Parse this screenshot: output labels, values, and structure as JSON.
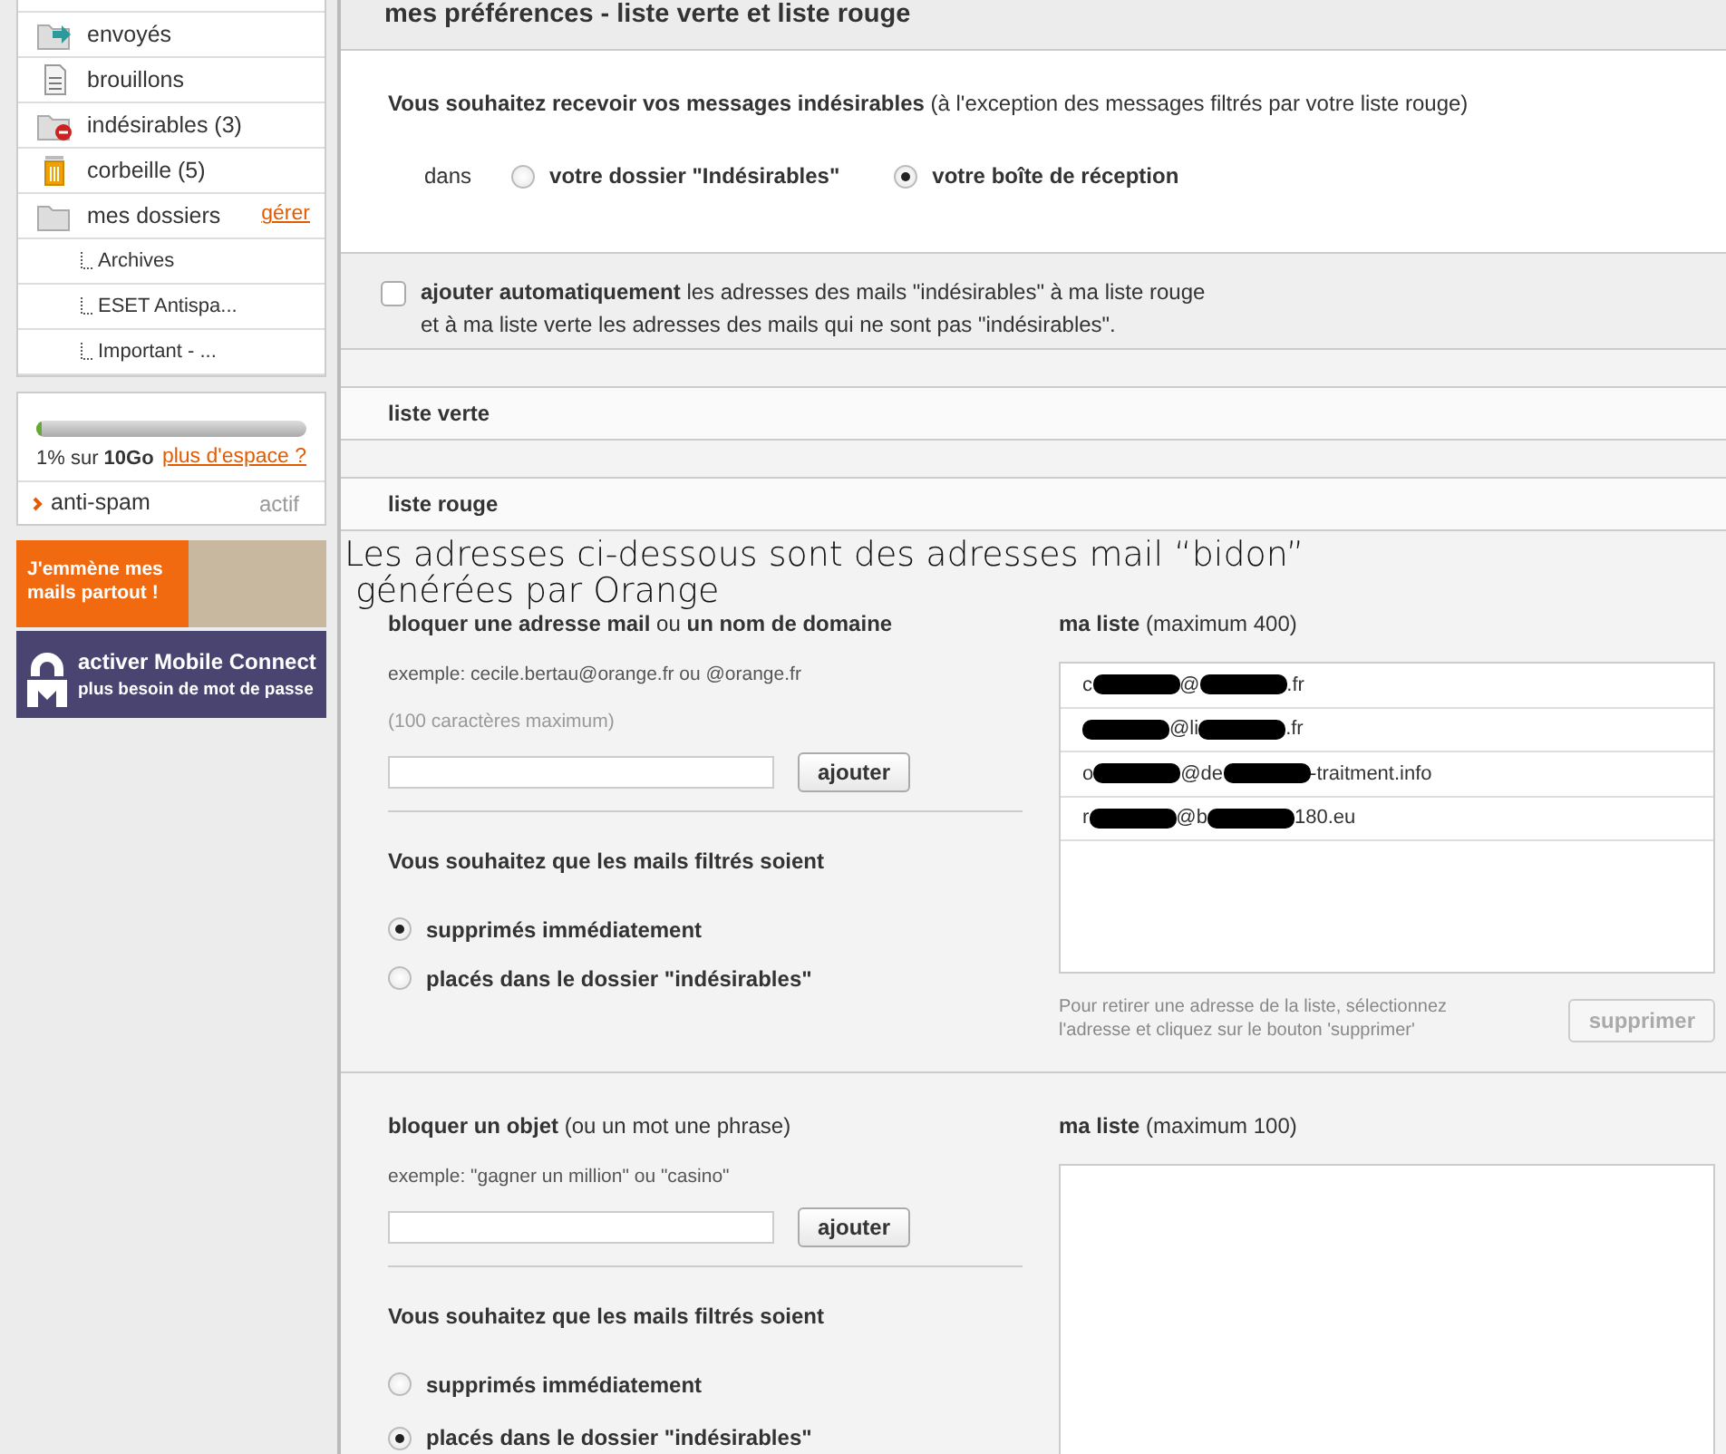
{
  "sidebar": {
    "folders": [
      {
        "kind": "sent",
        "label": "envoyés"
      },
      {
        "kind": "drafts",
        "label": "brouillons"
      },
      {
        "kind": "spam",
        "label": "indésirables (3)"
      },
      {
        "kind": "trash",
        "label": "corbeille (5)"
      },
      {
        "kind": "folders",
        "label": "mes dossiers",
        "link": "gérer"
      }
    ],
    "subfolders": [
      {
        "label": "Archives"
      },
      {
        "label": "ESET Antispa..."
      },
      {
        "label": "Important - ..."
      }
    ],
    "storage": {
      "level": 0.01,
      "text": "1% sur **10Go**",
      "link": "plus d'espace ?"
    },
    "antispam": {
      "label": "anti-spam",
      "status": "actif"
    },
    "promo": {
      "text": "J'emmène mes mails partout !"
    },
    "mobile_connect": {
      "title": "activer Mobile Connect",
      "subtitle": "plus besoin de mot de passe"
    }
  },
  "page_title": "mes préférences - liste verte et liste rouge",
  "delivery": {
    "question": "**Vous souhaitez recevoir vos messages indésirables** (à l'exception des messages filtrés par votre liste rouge)",
    "prefix": "dans",
    "options": [
      {
        "label": "votre dossier \"Indésirables\"",
        "selected": false
      },
      {
        "label": "votre boîte de réception",
        "selected": true
      }
    ]
  },
  "auto_add": {
    "checked": false,
    "lines": [
      "**ajouter automatiquement** les adresses des mails \"indésirables\" à ma liste rouge",
      "et à ma liste verte les adresses des mails qui ne sont pas \"indésirables\"."
    ]
  },
  "sections": [
    {
      "label": "liste verte"
    },
    {
      "label": "liste rouge"
    }
  ],
  "blockers": [
    {
      "heading": "**bloquer une adresse mail** ou **un nom de domaine**",
      "example": "exemple: cecile.bertau@orange.fr ou @orange.fr",
      "hint": "(100 caractères maximum)",
      "add_button": "ajouter",
      "filter_question": "Vous souhaitez que les mails filtrés soient",
      "filter_options": [
        {
          "label": "supprimés immédiatement",
          "selected": true
        },
        {
          "label": "placés dans le dossier \"indésirables\"",
          "selected": false
        }
      ],
      "list_heading": "**ma liste** (maximum 400)",
      "entries": [
        {
          "segments": [
            {
              "kind": "text",
              "text": "c"
            },
            {
              "kind": "redaction"
            },
            {
              "kind": "text",
              "text": "@"
            },
            {
              "kind": "redaction"
            },
            {
              "kind": "text",
              "text": ".fr"
            }
          ]
        },
        {
          "segments": [
            {
              "kind": "redaction"
            },
            {
              "kind": "text",
              "text": "@li"
            },
            {
              "kind": "redaction"
            },
            {
              "kind": "text",
              "text": ".fr"
            }
          ]
        },
        {
          "segments": [
            {
              "kind": "text",
              "text": "o"
            },
            {
              "kind": "redaction"
            },
            {
              "kind": "text",
              "text": "@de"
            },
            {
              "kind": "redaction"
            },
            {
              "kind": "text",
              "text": "-traitment.info"
            }
          ]
        },
        {
          "segments": [
            {
              "kind": "text",
              "text": "r"
            },
            {
              "kind": "redaction"
            },
            {
              "kind": "text",
              "text": "@b"
            },
            {
              "kind": "redaction"
            },
            {
              "kind": "text",
              "text": "180.eu"
            }
          ]
        }
      ],
      "remove_hint": "Pour retirer une adresse de la liste, sélectionnez l'adresse et cliquez sur le bouton 'supprimer'",
      "remove_button": {
        "label": "supprimer",
        "disabled": true
      }
    },
    {
      "heading": "**bloquer un objet** (ou un mot une phrase)",
      "example": "exemple: \"gagner un million\" ou \"casino\"",
      "add_button": "ajouter",
      "filter_question": "Vous souhaitez que les mails filtrés soient",
      "filter_options": [
        {
          "label": "supprimés immédiatement",
          "selected": false
        },
        {
          "label": "placés dans le dossier \"indésirables\"",
          "selected": true
        }
      ],
      "list_heading": "**ma liste** (maximum 100)"
    }
  ],
  "annotation": {
    "lines": [
      "Les adresses ci-dessous sont des adresses mail “bidon”",
      "générées par Orange"
    ]
  }
}
